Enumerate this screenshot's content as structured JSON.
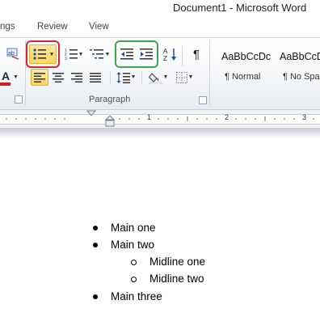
{
  "window": {
    "title": "Document1  -  Microsoft Word"
  },
  "tabs": [
    {
      "label": "ngs"
    },
    {
      "label": "Review"
    },
    {
      "label": "View"
    }
  ],
  "ribbon": {
    "paragraph_group": {
      "label": "Paragraph"
    },
    "styles": [
      {
        "sample": "AaBbCcDc",
        "name": "¶ Normal"
      },
      {
        "sample": "AaBbCcD",
        "name": "¶ No Spaci"
      }
    ],
    "font_color": "#d01f1f",
    "highlight_colors": {
      "bullets": "#d8262e",
      "indent": "#3aa64d"
    }
  },
  "ruler": {
    "numbers": [
      "1",
      "2",
      "3"
    ]
  },
  "document": {
    "list": [
      {
        "level": 1,
        "text": "Main one"
      },
      {
        "level": 1,
        "text": "Main two"
      },
      {
        "level": 2,
        "text": "Midline one"
      },
      {
        "level": 2,
        "text": "Midline two"
      },
      {
        "level": 1,
        "text": "Main three"
      }
    ]
  }
}
